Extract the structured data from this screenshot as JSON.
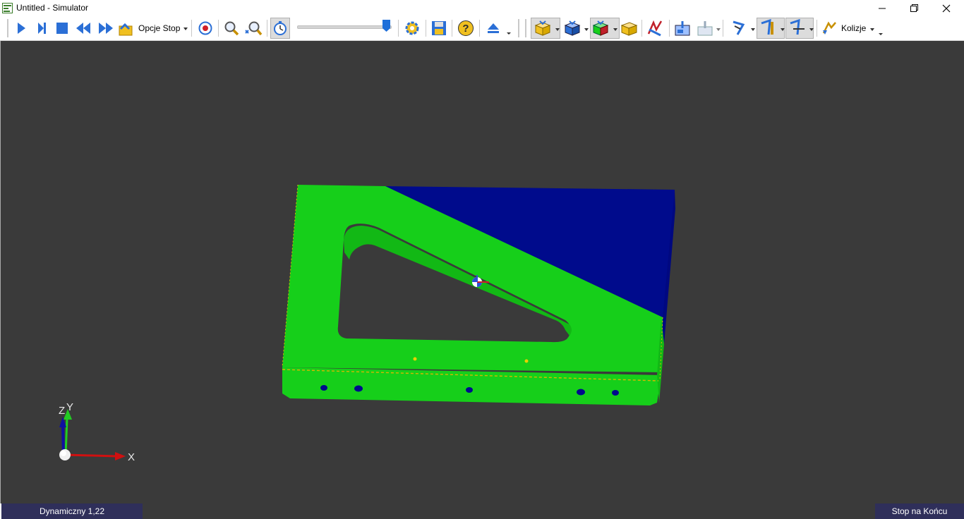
{
  "window": {
    "title": "Untitled - Simulator"
  },
  "toolbar": {
    "stop_options_label": "Opcje Stop",
    "collisions_label": "Kolizje",
    "speed_slider": {
      "value_fraction": 1.0
    }
  },
  "status": {
    "mode": "Dynamiczny 1,22",
    "stop_mode": "Stop na Końcu"
  },
  "axes": {
    "x_label": "X",
    "y_label": "Y",
    "z_label": "Z"
  },
  "colors": {
    "part_green": "#16cf1a",
    "stock_blue": "#000b8c",
    "viewport_bg": "#3a3a3a",
    "status_bg": "#2f2f5a"
  }
}
